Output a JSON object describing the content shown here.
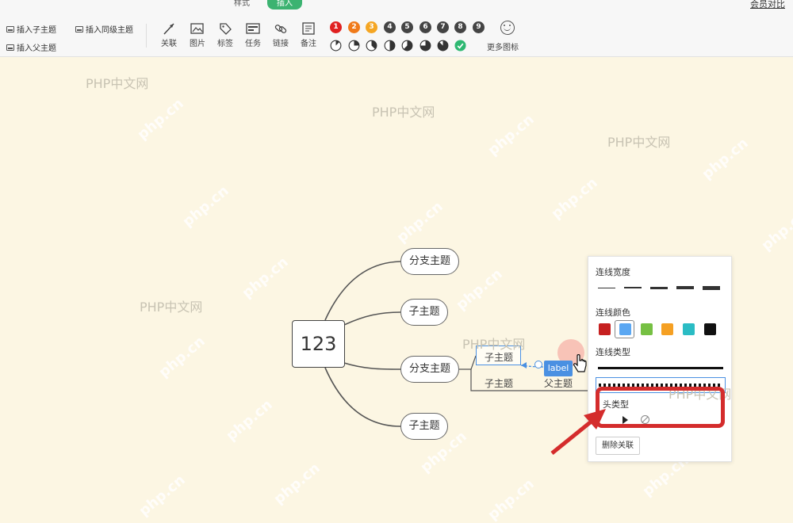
{
  "tabs": {
    "style": "样式",
    "insert": "插入",
    "member": "会员对比"
  },
  "toolbar": {
    "insert_child": "插入子主题",
    "insert_sibling": "插入同级主题",
    "insert_parent": "插入父主题",
    "tools": [
      "关联",
      "图片",
      "标签",
      "任务",
      "链接",
      "备注"
    ],
    "priorities": [
      {
        "n": "1",
        "color": "#e02020"
      },
      {
        "n": "2",
        "color": "#f07a1a"
      },
      {
        "n": "3",
        "color": "#f5a623"
      },
      {
        "n": "4",
        "color": "#444444"
      },
      {
        "n": "5",
        "color": "#444444"
      },
      {
        "n": "6",
        "color": "#444444"
      },
      {
        "n": "7",
        "color": "#444444"
      },
      {
        "n": "8",
        "color": "#444444"
      },
      {
        "n": "9",
        "color": "#444444"
      }
    ],
    "progress_levels": [
      0.125,
      0.25,
      0.375,
      0.5,
      0.625,
      0.75,
      0.875,
      1.0
    ],
    "more_icons": "更多图标"
  },
  "canvas": {
    "watermark": "PHP中文网",
    "diag_watermark": "php.cn",
    "central": "123",
    "branch1": "分支主题",
    "sub1": "子主题",
    "branch2": "分支主题",
    "sub2": "子主题",
    "sub_sel": "子主题",
    "sub_low": "子主题",
    "parent": "父主题",
    "label": "label"
  },
  "panel": {
    "width_title": "连线宽度",
    "color_title": "连线颜色",
    "colors": [
      "#c62020",
      "#5aa7f2",
      "#76c043",
      "#f5a023",
      "#2bbcc4",
      "#111111"
    ],
    "type_title": "连线类型",
    "head_title": "头类型",
    "delete_btn": "删除关联"
  }
}
